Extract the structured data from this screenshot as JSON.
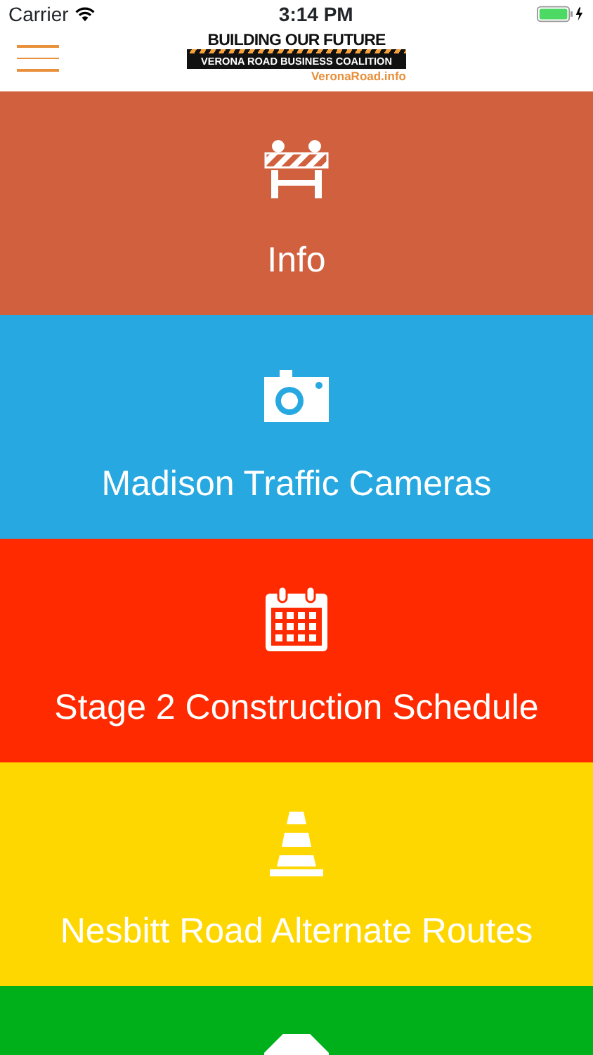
{
  "status_bar": {
    "carrier": "Carrier",
    "time": "3:14 PM"
  },
  "header": {
    "logo_title": "BUILDING OUR FUTURE",
    "logo_subtitle": "VERONA ROAD BUSINESS COALITION",
    "logo_url": "VeronaRoad.info"
  },
  "tiles": [
    {
      "label": "Info",
      "kind": "barrier",
      "color": "#d0603e"
    },
    {
      "label": "Madison Traffic Cameras",
      "kind": "camera",
      "color": "#27a8e0"
    },
    {
      "label": "Stage 2 Construction Schedule",
      "kind": "calendar",
      "color": "#ff2a00"
    },
    {
      "label": "Nesbitt Road Alternate Routes",
      "kind": "cone",
      "color": "#ffd700"
    },
    {
      "kind": "stop",
      "color": "#00b01a"
    }
  ]
}
